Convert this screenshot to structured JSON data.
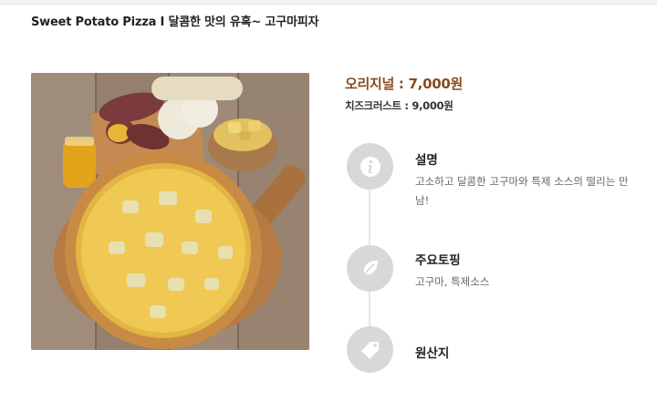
{
  "page_title": "Sweet Potato Pizza I 달콤한 맛의 유혹~ 고구마피자",
  "prices": {
    "original": "오리지널 : 7,000원",
    "cheese_crust": "치즈크러스트 : 9,000원"
  },
  "sections": [
    {
      "title": "설명",
      "text": "고소하고 달콤한 고구마와 특제 소스의 떨리는 만남!",
      "icon": "info-icon"
    },
    {
      "title": "주요토핑",
      "text": "고구마, 특제소스",
      "icon": "leaf-icon"
    },
    {
      "title": "원산지",
      "text": "",
      "icon": "tag-icon"
    }
  ],
  "colors": {
    "accent": "#8a4a1b",
    "icon_bg": "#d8d8d8"
  }
}
